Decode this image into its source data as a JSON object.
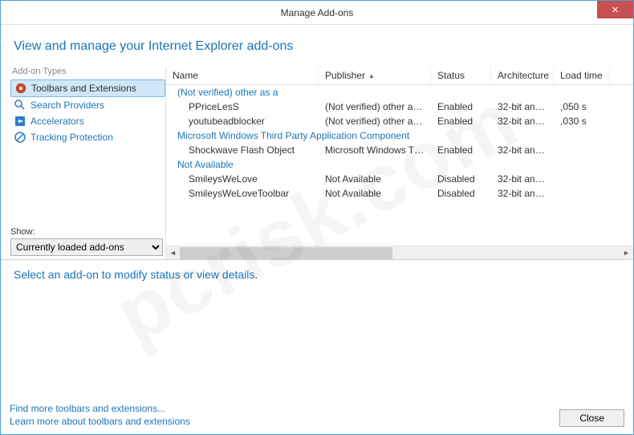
{
  "window": {
    "title": "Manage Add-ons",
    "close": "✕"
  },
  "header": {
    "title": "View and manage your Internet Explorer add-ons"
  },
  "sidebar": {
    "types_label": "Add-on Types",
    "items": [
      {
        "label": "Toolbars and Extensions",
        "selected": true
      },
      {
        "label": "Search Providers",
        "selected": false
      },
      {
        "label": "Accelerators",
        "selected": false
      },
      {
        "label": "Tracking Protection",
        "selected": false
      }
    ],
    "show_label": "Show:",
    "show_value": "Currently loaded add-ons"
  },
  "grid": {
    "headers": {
      "name": "Name",
      "publisher": "Publisher",
      "status": "Status",
      "architecture": "Architecture",
      "load_time": "Load time"
    },
    "groups": [
      {
        "title": "(Not verified) other as a",
        "rows": [
          {
            "name": "PPriceLesS",
            "publisher": "(Not verified) other as a",
            "status": "Enabled",
            "arch": "32-bit and ...",
            "load": ",050 s"
          },
          {
            "name": "youtubeadblocker",
            "publisher": "(Not verified) other as a",
            "status": "Enabled",
            "arch": "32-bit and ...",
            "load": ",030 s"
          }
        ]
      },
      {
        "title": "Microsoft Windows Third Party Application Component",
        "rows": [
          {
            "name": "Shockwave Flash Object",
            "publisher": "Microsoft Windows Third...",
            "status": "Enabled",
            "arch": "32-bit and ...",
            "load": ""
          }
        ]
      },
      {
        "title": "Not Available",
        "rows": [
          {
            "name": "SmileysWeLove",
            "publisher": "Not Available",
            "status": "Disabled",
            "arch": "32-bit and ...",
            "load": ""
          },
          {
            "name": "SmileysWeLoveToolbar",
            "publisher": "Not Available",
            "status": "Disabled",
            "arch": "32-bit and ...",
            "load": ""
          }
        ]
      }
    ]
  },
  "detail": {
    "prompt": "Select an add-on to modify status or view details."
  },
  "footer": {
    "link1": "Find more toolbars and extensions...",
    "link2": "Learn more about toolbars and extensions",
    "close_label": "Close"
  }
}
